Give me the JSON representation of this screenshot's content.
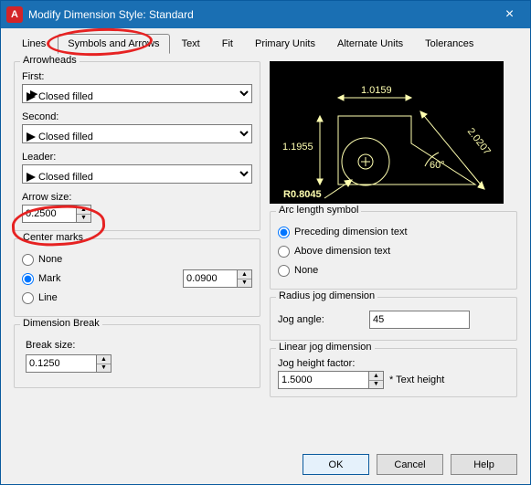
{
  "window": {
    "title": "Modify Dimension Style: Standard"
  },
  "tabs": {
    "lines": "Lines",
    "symbols": "Symbols and Arrows",
    "text": "Text",
    "fit": "Fit",
    "primary": "Primary Units",
    "alternate": "Alternate Units",
    "tolerances": "Tolerances"
  },
  "arrowheads": {
    "title": "Arrowheads",
    "first_label": "First:",
    "first_value": "Closed filled",
    "second_label": "Second:",
    "second_value": "Closed filled",
    "leader_label": "Leader:",
    "leader_value": "Closed filled",
    "size_label": "Arrow size:",
    "size_value": "0.2500"
  },
  "centermarks": {
    "title": "Center marks",
    "none": "None",
    "mark": "Mark",
    "line": "Line",
    "value": "0.0900"
  },
  "dimbreak": {
    "title": "Dimension Break",
    "size_label": "Break size:",
    "size_value": "0.1250"
  },
  "arclen": {
    "title": "Arc length symbol",
    "preceding": "Preceding dimension text",
    "above": "Above dimension text",
    "none": "None"
  },
  "radjog": {
    "title": "Radius jog dimension",
    "angle_label": "Jog angle:",
    "angle_value": "45"
  },
  "linjog": {
    "title": "Linear jog dimension",
    "factor_label": "Jog height factor:",
    "factor_value": "1.5000",
    "suffix": "* Text height"
  },
  "preview": {
    "d1": "1.0159",
    "d2": "1.1955",
    "d3": "2.0207",
    "angle": "60°",
    "radius": "R0.8045"
  },
  "buttons": {
    "ok": "OK",
    "cancel": "Cancel",
    "help": "Help"
  }
}
